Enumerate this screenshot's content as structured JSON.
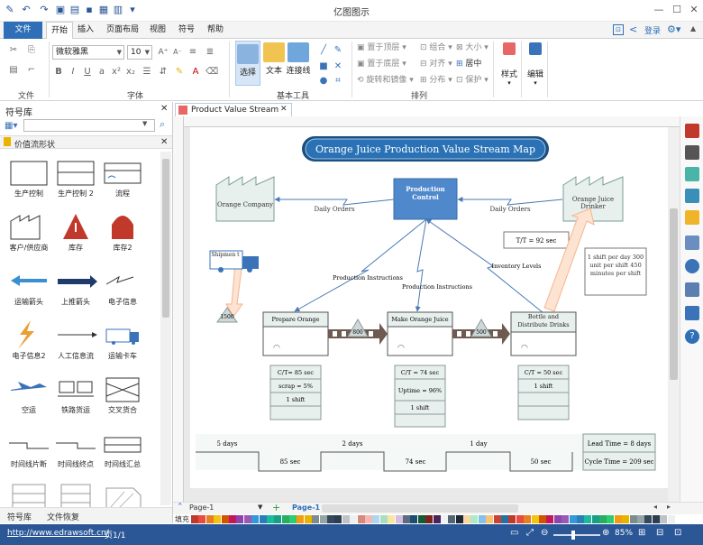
{
  "app": {
    "title": "亿图图示"
  },
  "menu": {
    "file": "文件",
    "tabs": [
      "开始",
      "插入",
      "页面布局",
      "视图",
      "符号",
      "帮助"
    ],
    "login": "登录"
  },
  "ribbon": {
    "font_name": "微软雅黑",
    "font_size": "10",
    "groups": {
      "file": "文件",
      "font": "字体",
      "basic_tools": "基本工具",
      "arrange": "排列"
    },
    "tools": {
      "select": "选择",
      "text": "文本",
      "connector": "连接线",
      "style": "样式",
      "edit": "编辑"
    },
    "arrange": {
      "bring_front": "置于顶层",
      "send_back": "置于底层",
      "rotate": "旋转和镜像",
      "group": "组合",
      "align": "对齐",
      "distribute": "分布",
      "size": "大小",
      "center": "居中",
      "protect": "保护"
    }
  },
  "library": {
    "title": "符号库",
    "category": "价值流形状",
    "shapes": [
      "生产控制",
      "生产控制 2",
      "流程",
      "客户/供应商",
      "库存",
      "库存2",
      "运输箭头",
      "上推箭头",
      "电子信息",
      "电子信息2",
      "人工信息流",
      "运输卡车",
      "空运",
      "铁路货运",
      "交叉货合",
      "时间线片断",
      "时间线终点",
      "时间线汇总",
      "",
      "",
      ""
    ],
    "tabs": [
      "符号库",
      "文件恢复"
    ]
  },
  "document": {
    "tab_name": "Product Value Stream"
  },
  "diagram": {
    "title": "Orange Juice Production Value Stream Map",
    "production_control": "Production Control",
    "supplier": "Orange Company",
    "customer": "Orange Juice Drinker",
    "daily_orders": "Daily Orders",
    "daily_orders2": "Daily Orders",
    "takt": "T/T = 92 sec",
    "customer_note": "1 shift per day 300 unit per shift 450 minutes per shift",
    "shipment": "Shipmen t",
    "inventory_1500": "1500",
    "prod_instr_1": "Production Instructions",
    "prod_instr_2": "Production Instructions",
    "inventory_levels": "Inventory Levels",
    "processes": [
      {
        "name": "Prepare Orange",
        "data": [
          "C/T= 85 sec",
          "scrap = 5%",
          "1 shift"
        ]
      },
      {
        "name": "Make Orange Juice",
        "data": [
          "C/T = 74 sec",
          "Uptime = 96%",
          "1 shift"
        ]
      },
      {
        "name": "Bottle and Distribute Drinks",
        "data": [
          "C/T = 50 sec",
          "1 shift"
        ]
      }
    ],
    "push_labels": [
      "800",
      "500"
    ],
    "timeline": {
      "days": [
        "5 days",
        "2 days",
        "1 day"
      ],
      "secs": [
        "85 sec",
        "74 sec",
        "50 sec"
      ],
      "lead_time": "Lead Time = 8 days",
      "cycle_time": "Cycle Time = 209 sec"
    }
  },
  "pagebar": {
    "page_select": "Page-1",
    "page_tab": "Page-1"
  },
  "palette": {
    "fill_label": "填充"
  },
  "status": {
    "url": "http://www.edrawsoft.cn/",
    "page": "页1/1",
    "zoom": "85%"
  }
}
